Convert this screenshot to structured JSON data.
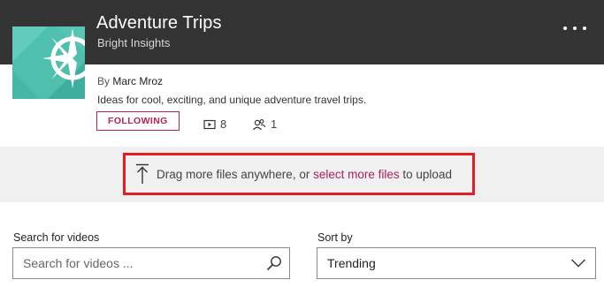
{
  "channel": {
    "title": "Adventure Trips",
    "subtitle": "Bright Insights",
    "by_prefix": "By",
    "author": "Marc Mroz",
    "description": "Ideas for cool, exciting, and unique adventure travel trips.",
    "follow_label": "FOLLOWING",
    "video_count": "8",
    "follower_count": "1"
  },
  "upload": {
    "text_before": "Drag more files anywhere, or",
    "link_text": "select more files",
    "text_after": "to upload"
  },
  "search": {
    "label": "Search for videos",
    "placeholder": "Search for videos ..."
  },
  "sort": {
    "label": "Sort by",
    "selected": "Trending"
  },
  "colors": {
    "header_bg": "#333333",
    "accent": "#b4235a",
    "highlight_border": "#e31e24",
    "logo_teal": "#4fbfae"
  },
  "icons": {
    "logo": "compass-rose-icon",
    "more": "ellipsis-icon",
    "videos": "video-icon",
    "followers": "followers-icon",
    "upload": "upload-arrow-icon",
    "search": "search-icon",
    "sort": "chevron-down-icon"
  }
}
